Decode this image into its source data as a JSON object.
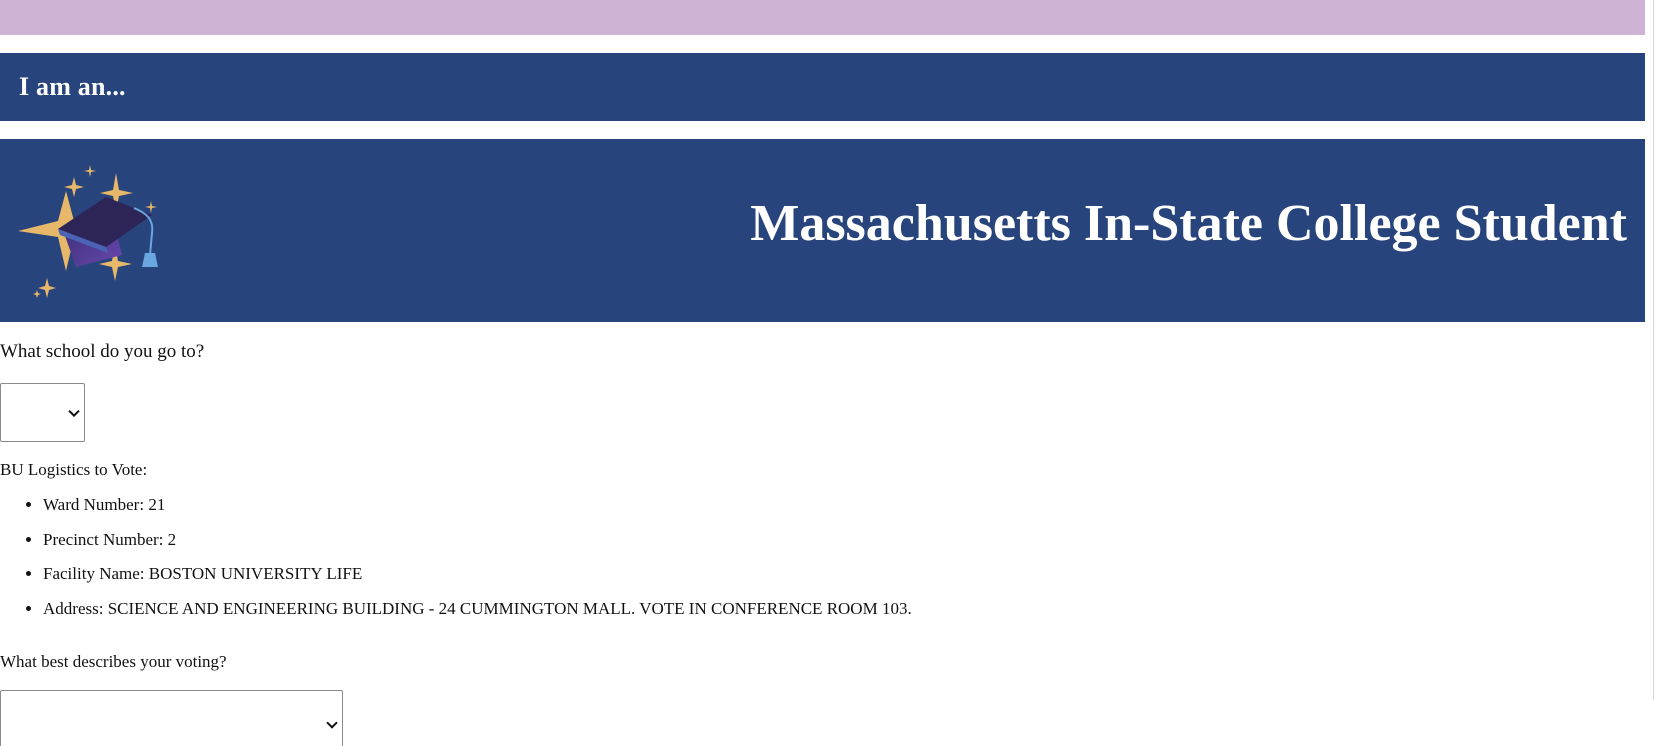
{
  "header": {
    "iam_title": "I am an...",
    "banner_title": "Massachusetts In-State College Student",
    "banner_icon": "graduation-cap-sparkles-icon"
  },
  "school": {
    "question": "What school do you go to?",
    "selected_value": ""
  },
  "logistics": {
    "label": "BU Logistics to Vote:",
    "items": [
      "Ward Number: 21",
      "Precinct Number: 2",
      "Facility Name: BOSTON UNIVERSITY LIFE",
      "Address: SCIENCE AND ENGINEERING BUILDING - 24 CUMMINGTON MALL. VOTE IN CONFERENCE ROOM 103."
    ]
  },
  "voting": {
    "question": "What best describes your voting?",
    "selected_value": ""
  },
  "colors": {
    "top_band": "#cfb3d5",
    "header_navy": "#28447c",
    "sparkle_gold": "#e8b86a",
    "cap_purple": "#2d2458"
  }
}
